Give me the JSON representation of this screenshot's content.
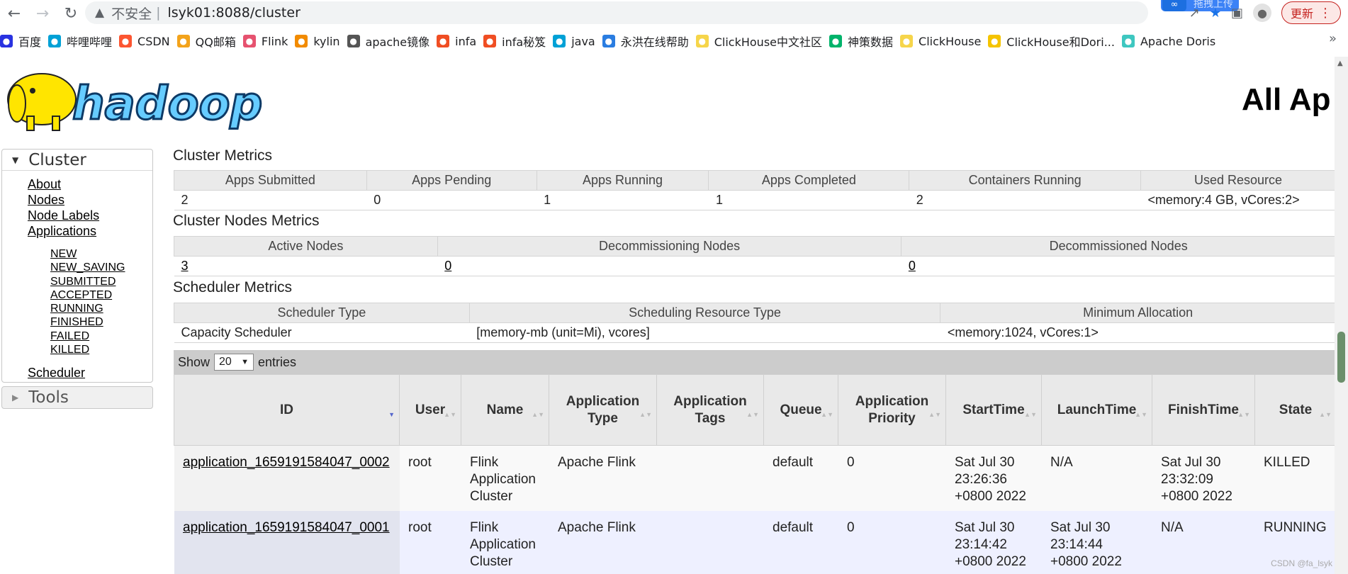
{
  "browser": {
    "url_warning": "不安全",
    "url_separator": "|",
    "url": "lsyk01:8088/cluster",
    "extension_popup": "拖拽上传",
    "update_label": "更新"
  },
  "bookmarks": [
    {
      "label": "百度",
      "icon": "baidu-icon",
      "color": "#2932e1"
    },
    {
      "label": "哔哩哔哩",
      "icon": "bilibili-icon",
      "color": "#00a1d6"
    },
    {
      "label": "CSDN",
      "icon": "csdn-icon",
      "color": "#fc5531"
    },
    {
      "label": "QQ邮箱",
      "icon": "qqmail-icon",
      "color": "#f3a31b"
    },
    {
      "label": "Flink",
      "icon": "flink-icon",
      "color": "#e6526f"
    },
    {
      "label": "kylin",
      "icon": "kylin-icon",
      "color": "#f28b00"
    },
    {
      "label": "apache镜像",
      "icon": "globe-icon",
      "color": "#555555"
    },
    {
      "label": "infa",
      "icon": "infa-icon",
      "color": "#f04e23"
    },
    {
      "label": "infa秘笈",
      "icon": "infa-icon",
      "color": "#f04e23"
    },
    {
      "label": "java",
      "icon": "bilibili-icon",
      "color": "#00a1d6"
    },
    {
      "label": "永洪在线帮助",
      "icon": "yonghong-icon",
      "color": "#2a7de1"
    },
    {
      "label": "ClickHouse中文社区",
      "icon": "clickhouse-icon",
      "color": "#f6d54a"
    },
    {
      "label": "神策数据",
      "icon": "sensors-icon",
      "color": "#00b36b"
    },
    {
      "label": "ClickHouse",
      "icon": "clickhouse-icon",
      "color": "#f6d54a"
    },
    {
      "label": "ClickHouse和Dori...",
      "icon": "s-icon",
      "color": "#f5c400"
    },
    {
      "label": "Apache Doris",
      "icon": "doris-icon",
      "color": "#3ec7c0"
    }
  ],
  "page": {
    "heading": "All Ap",
    "logo_text": "hadoop"
  },
  "sidebar": {
    "cluster_title": "Cluster",
    "main_links": [
      "About",
      "Nodes",
      "Node Labels",
      "Applications"
    ],
    "app_states": [
      "NEW",
      "NEW_SAVING",
      "SUBMITTED",
      "ACCEPTED",
      "RUNNING",
      "FINISHED",
      "FAILED",
      "KILLED"
    ],
    "scheduler_link": "Scheduler",
    "tools_title": "Tools"
  },
  "cluster_metrics": {
    "title": "Cluster Metrics",
    "headers": [
      "Apps Submitted",
      "Apps Pending",
      "Apps Running",
      "Apps Completed",
      "Containers Running",
      "Used Resource"
    ],
    "values": [
      "2",
      "0",
      "1",
      "1",
      "2",
      "<memory:4 GB, vCores:2>"
    ]
  },
  "nodes_metrics": {
    "title": "Cluster Nodes Metrics",
    "headers": [
      "Active Nodes",
      "Decommissioning Nodes",
      "Decommissioned Nodes"
    ],
    "values": [
      "3",
      "0",
      "0"
    ]
  },
  "scheduler_metrics": {
    "title": "Scheduler Metrics",
    "headers": [
      "Scheduler Type",
      "Scheduling Resource Type",
      "Minimum Allocation"
    ],
    "values": [
      "Capacity Scheduler",
      "[memory-mb (unit=Mi), vcores]",
      "<memory:1024, vCores:1>"
    ]
  },
  "apps": {
    "show_label": "Show",
    "entries_value": "20",
    "entries_label": "entries",
    "headers": [
      "ID",
      "User",
      "Name",
      "Application Type",
      "Application Tags",
      "Queue",
      "Application Priority",
      "StartTime",
      "LaunchTime",
      "FinishTime",
      "State"
    ],
    "rows": [
      {
        "id": "application_1659191584047_0002",
        "user": "root",
        "name": "Flink Application Cluster",
        "type": "Apache Flink",
        "tags": "",
        "queue": "default",
        "priority": "0",
        "start": "Sat Jul 30 23:26:36 +0800 2022",
        "launch": "N/A",
        "finish": "Sat Jul 30 23:32:09 +0800 2022",
        "state": "KILLED"
      },
      {
        "id": "application_1659191584047_0001",
        "user": "root",
        "name": "Flink Application Cluster",
        "type": "Apache Flink",
        "tags": "",
        "queue": "default",
        "priority": "0",
        "start": "Sat Jul 30 23:14:42 +0800 2022",
        "launch": "Sat Jul 30 23:14:44 +0800 2022",
        "finish": "N/A",
        "state": "RUNNING"
      }
    ]
  },
  "watermark": "CSDN @fa_lsyk"
}
